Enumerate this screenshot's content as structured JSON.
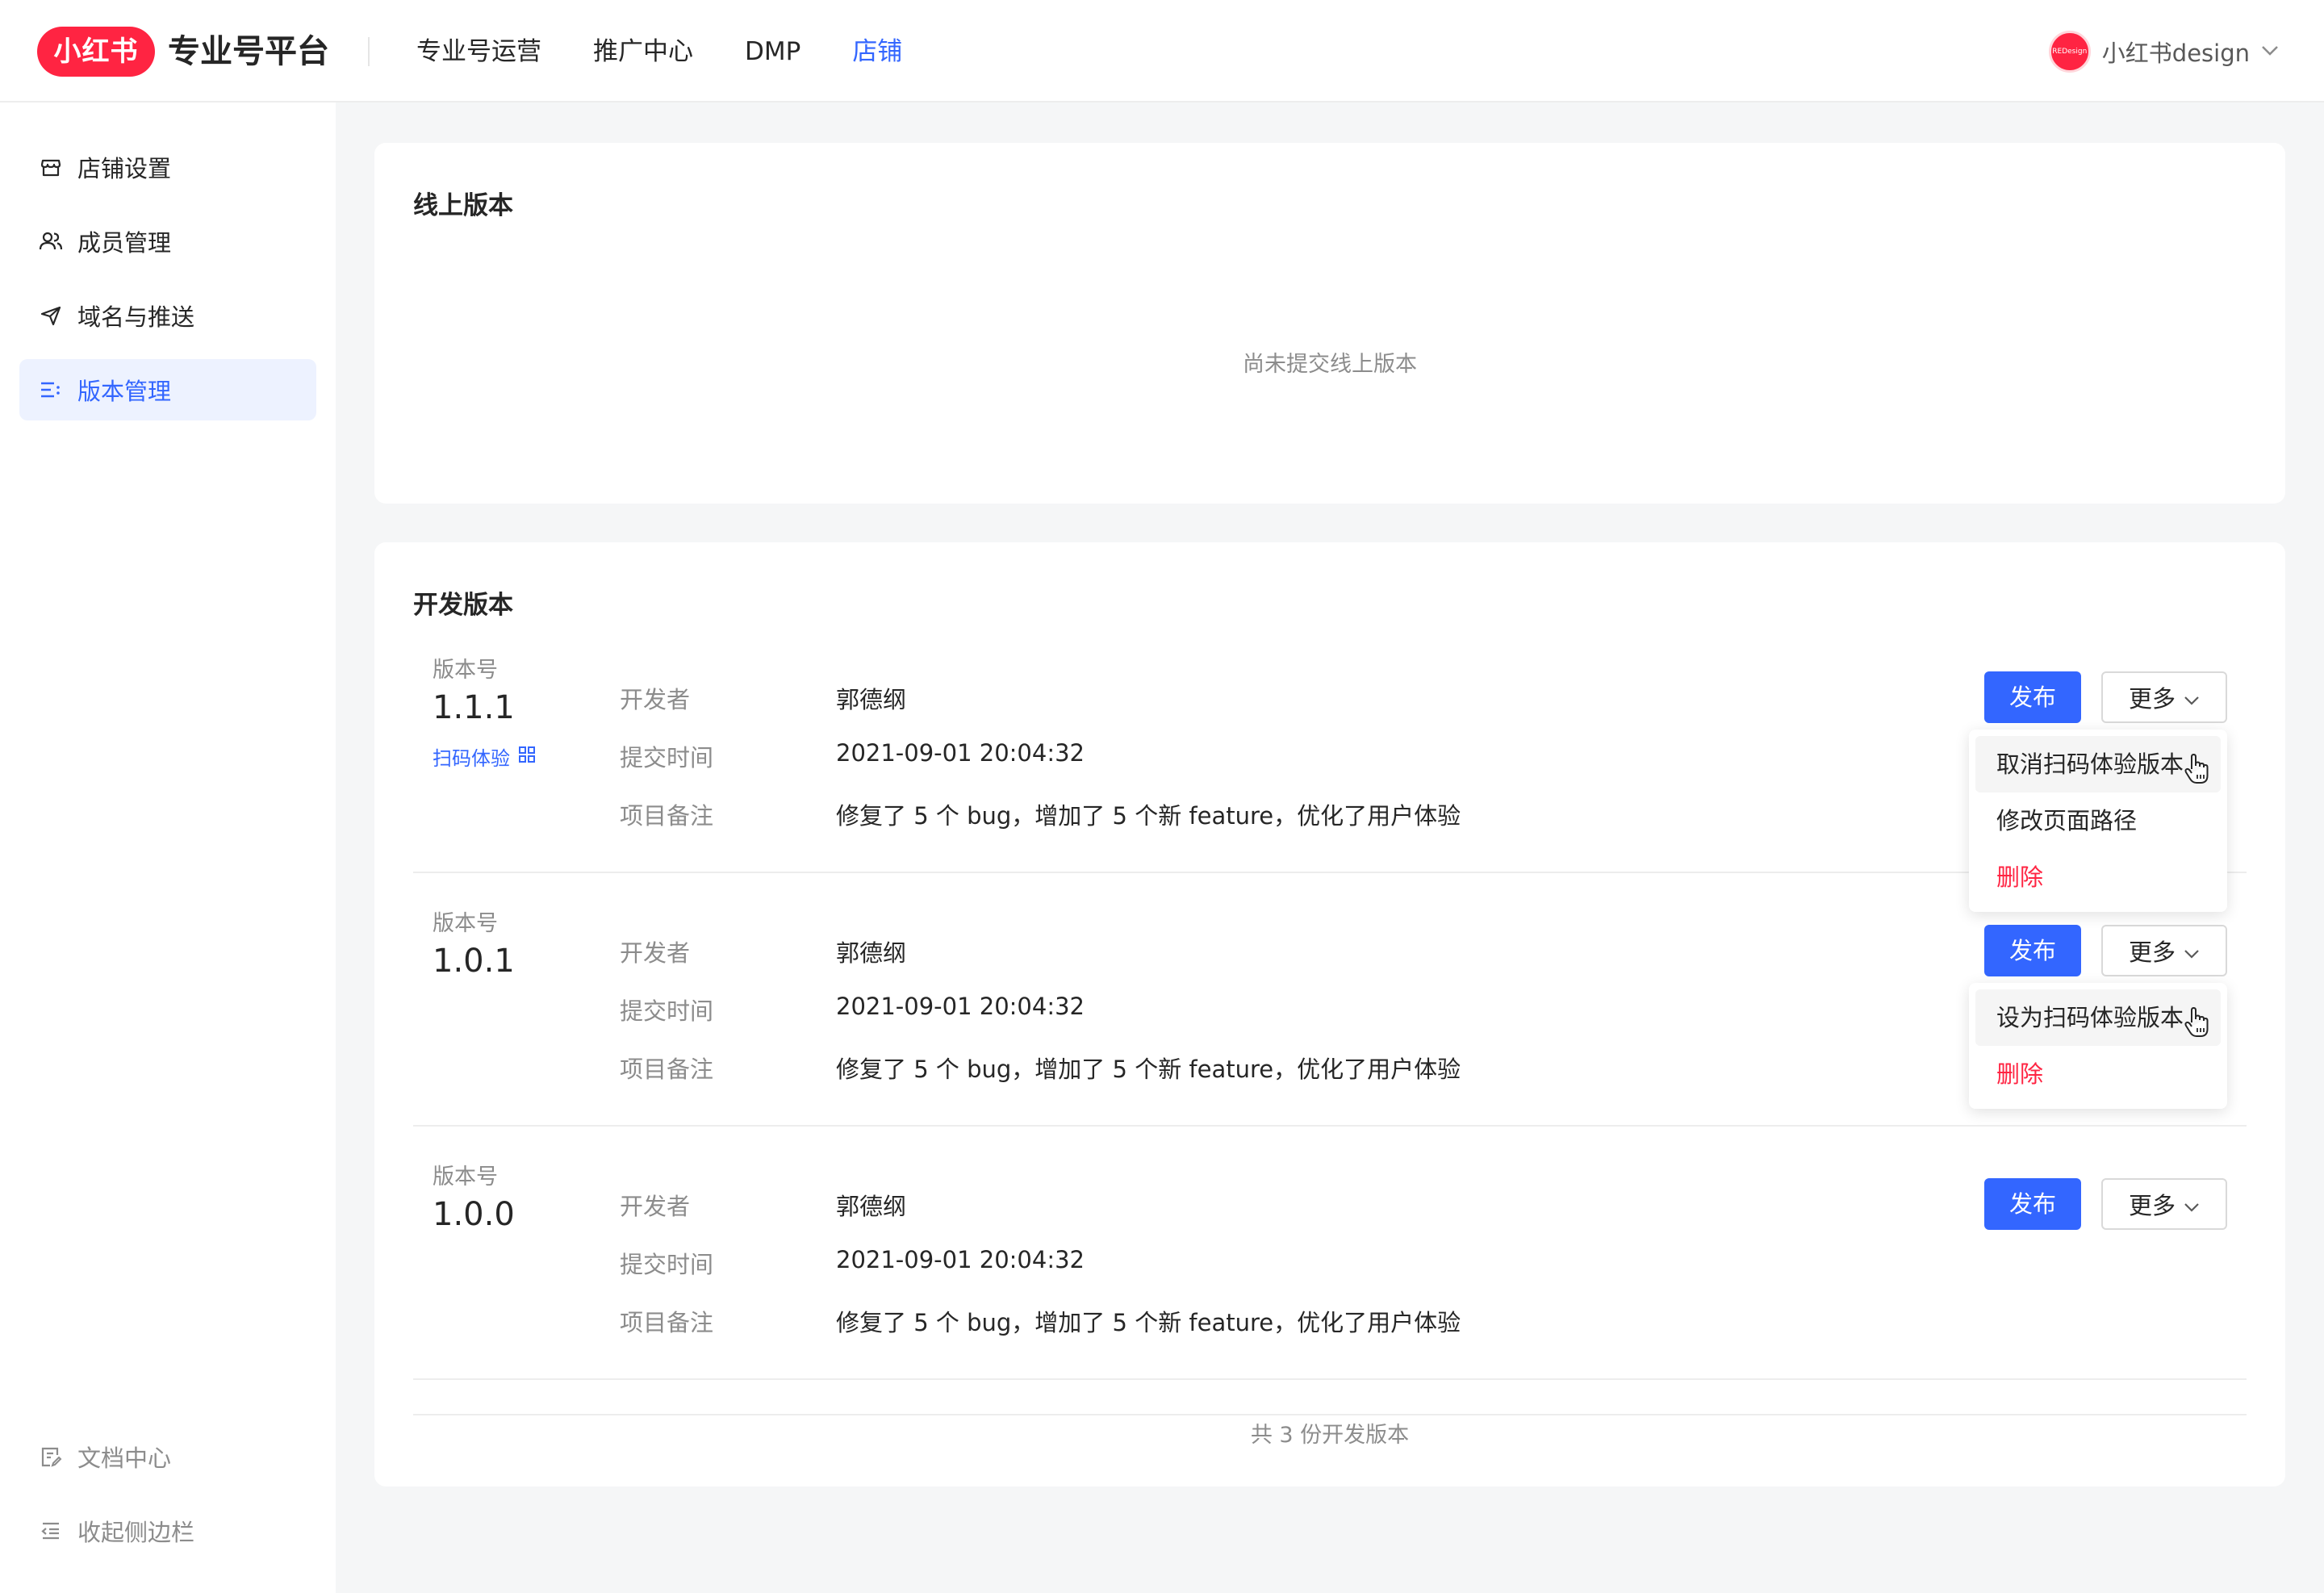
{
  "header": {
    "logo_text": "小红书",
    "platform_title": "专业号平台",
    "nav": [
      {
        "label": "专业号运营",
        "active": false
      },
      {
        "label": "推广中心",
        "active": false
      },
      {
        "label": "DMP",
        "active": false
      },
      {
        "label": "店铺",
        "active": true
      }
    ],
    "user": {
      "avatar_text": "REDesign",
      "name": "小红书design"
    }
  },
  "sidebar": {
    "items": [
      {
        "label": "店铺设置",
        "icon": "store-icon"
      },
      {
        "label": "成员管理",
        "icon": "members-icon"
      },
      {
        "label": "域名与推送",
        "icon": "send-icon"
      },
      {
        "label": "版本管理",
        "icon": "list-icon",
        "active": true
      }
    ],
    "bottom": [
      {
        "label": "文档中心",
        "icon": "document-icon"
      },
      {
        "label": "收起侧边栏",
        "icon": "collapse-icon"
      }
    ]
  },
  "online": {
    "title": "线上版本",
    "empty_text": "尚未提交线上版本"
  },
  "dev": {
    "title": "开发版本",
    "field_labels": {
      "version": "版本号",
      "developer": "开发者",
      "submit_time": "提交时间",
      "remark": "项目备注"
    },
    "publish_label": "发布",
    "more_label": "更多",
    "versions": [
      {
        "number": "1.1.1",
        "scan_label": "扫码体验",
        "developer": "郭德纲",
        "submit_time": "2021-09-01 20:04:32",
        "remark": "修复了 5 个 bug，增加了 5 个新 feature，优化了用户体验",
        "menu": [
          "取消扫码体验版本",
          "修改页面路径",
          "删除"
        ]
      },
      {
        "number": "1.0.1",
        "developer": "郭德纲",
        "submit_time": "2021-09-01 20:04:32",
        "remark": "修复了 5 个 bug，增加了 5 个新 feature，优化了用户体验",
        "menu": [
          "设为扫码体验版本",
          "删除"
        ]
      },
      {
        "number": "1.0.0",
        "developer": "郭德纲",
        "submit_time": "2021-09-01 20:04:32",
        "remark": "修复了 5 个 bug，增加了 5 个新 feature，优化了用户体验"
      }
    ],
    "footer": "共 3 份开发版本"
  },
  "colors": {
    "brand": "#ff2442",
    "primary": "#3366ff",
    "danger": "#ff2442"
  }
}
